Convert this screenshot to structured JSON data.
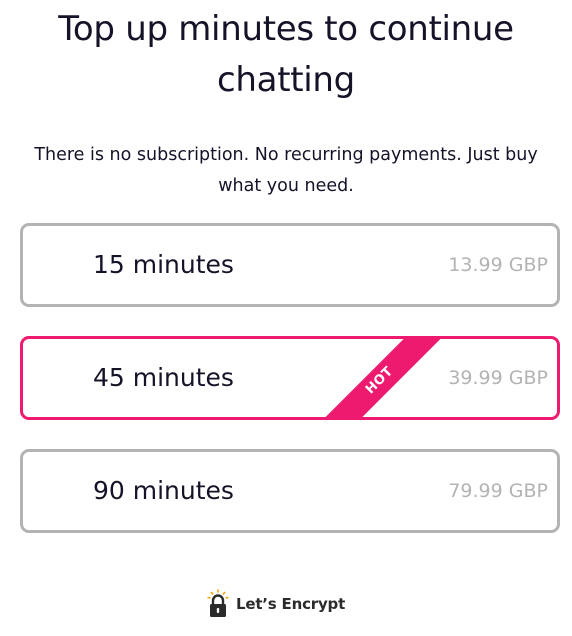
{
  "header": {
    "title": "Top up minutes to continue chatting",
    "subtitle": "There is no subscription. No recurring payments. Just buy what you need."
  },
  "options": [
    {
      "label": "15 minutes",
      "price": "13.99 GBP",
      "highlighted": false
    },
    {
      "label": "45 minutes",
      "price": "39.99 GBP",
      "highlighted": true,
      "ribbon": "HOT"
    },
    {
      "label": "90 minutes",
      "price": "79.99 GBP",
      "highlighted": false
    }
  ],
  "footer": {
    "badge_text": "Let’s Encrypt",
    "badge_icon": "padlock-icon"
  },
  "colors": {
    "accent": "#ee1a6f",
    "border": "#b3b3b3",
    "text": "#141328",
    "price": "#b3b3b3"
  }
}
